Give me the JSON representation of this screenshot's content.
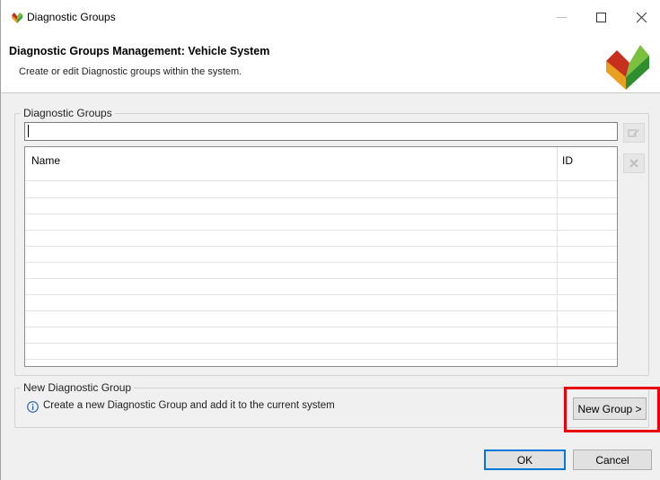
{
  "window": {
    "title": "Diagnostic Groups"
  },
  "banner": {
    "title": "Diagnostic Groups Management: Vehicle System",
    "description": "Create or edit Diagnostic groups within the system."
  },
  "diagnostic_groups": {
    "label": "Diagnostic Groups",
    "filter_value": "",
    "table": {
      "columns": [
        "Name",
        "ID"
      ],
      "rows": []
    }
  },
  "new_group": {
    "label": "New Diagnostic Group",
    "info": "Create a new Diagnostic Group and add it to the current system",
    "button_label": "New Group >"
  },
  "dialog": {
    "ok_label": "OK",
    "cancel_label": "Cancel"
  },
  "colors": {
    "highlight": "#e8000b",
    "default_button_border": "#0078d7"
  },
  "icons": [
    "app-logo-icon",
    "minimize-icon",
    "maximize-icon",
    "close-icon",
    "edit-icon",
    "delete-icon",
    "info-icon"
  ]
}
